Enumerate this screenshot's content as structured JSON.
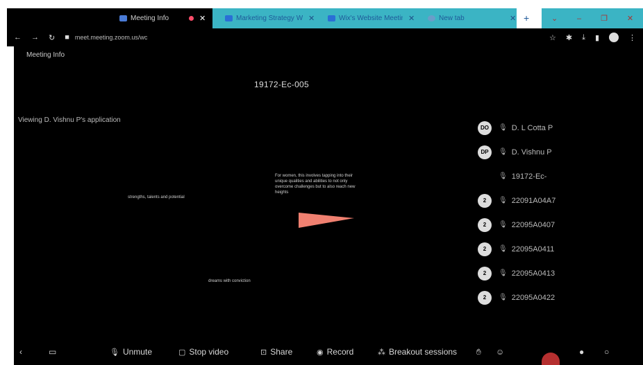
{
  "tabs": [
    {
      "label": "Meeting Info",
      "active": true
    },
    {
      "label": "Marketing Strategy Wh",
      "active": false
    },
    {
      "label": "Wix's Website Meeting",
      "active": false
    },
    {
      "label": "New tab",
      "active": false
    }
  ],
  "browser": {
    "url": "meet.meeting.zoom.us/wc"
  },
  "meeting": {
    "info_label": "Meeting Info",
    "id": "19172-Ec-005",
    "viewing_label": "Viewing D. Vishnu P's application",
    "slide_texts": [
      "strengths, talents and potential",
      "For women, this involves tapping into their unique qualities and abilities to not only overcome challenges but to also reach new heights",
      "dreams with conviction"
    ]
  },
  "participants": [
    {
      "badge": "DO",
      "name": "D. L Cotta P"
    },
    {
      "badge": "DP",
      "name": "D. Vishnu P"
    },
    {
      "badge": "",
      "name": "19172-Ec-"
    },
    {
      "badge": "2",
      "name": "22091A04A7"
    },
    {
      "badge": "2",
      "name": "22095A0407"
    },
    {
      "badge": "2",
      "name": "22095A0411"
    },
    {
      "badge": "2",
      "name": "22095A0413"
    },
    {
      "badge": "2",
      "name": "22095A0422"
    }
  ],
  "toolbar": {
    "unmute": "Unmute",
    "stop_video": "Stop video",
    "share": "Share",
    "record": "Record",
    "breakout": "Breakout sessions"
  },
  "colors": {
    "tab_inactive_bg": "#3bb4c4",
    "pointer": "#f08070",
    "background": "#000000"
  }
}
